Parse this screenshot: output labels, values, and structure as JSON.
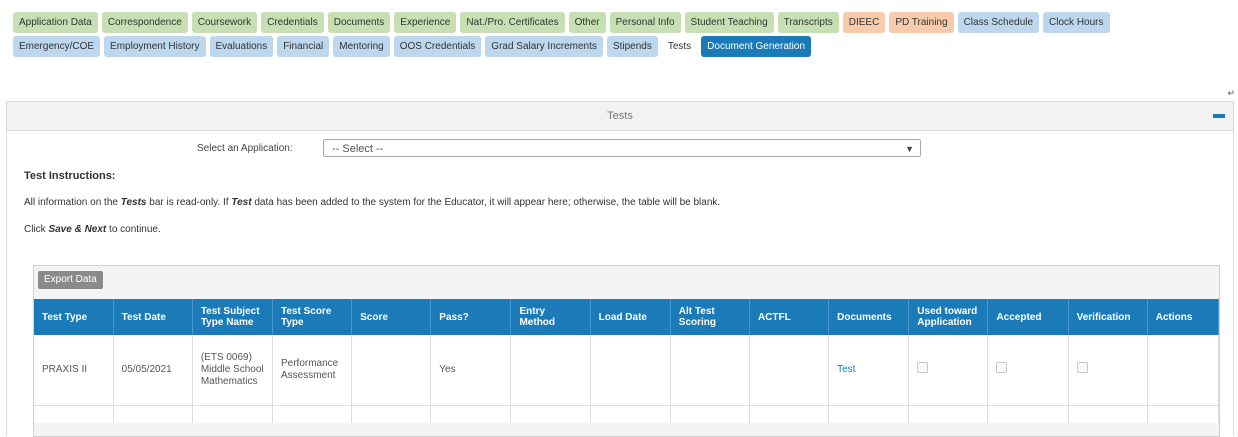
{
  "tabs": {
    "row1": [
      {
        "label": "Application Data",
        "color": "green"
      },
      {
        "label": "Correspondence",
        "color": "green"
      },
      {
        "label": "Coursework",
        "color": "green"
      },
      {
        "label": "Credentials",
        "color": "green"
      },
      {
        "label": "Documents",
        "color": "green"
      },
      {
        "label": "Experience",
        "color": "green"
      },
      {
        "label": "Nat./Pro. Certificates",
        "color": "green"
      },
      {
        "label": "Other",
        "color": "green"
      },
      {
        "label": "Personal Info",
        "color": "green"
      },
      {
        "label": "Student Teaching",
        "color": "green"
      },
      {
        "label": "Transcripts",
        "color": "green"
      },
      {
        "label": "DIEEC",
        "color": "orange"
      },
      {
        "label": "PD Training",
        "color": "orange"
      },
      {
        "label": "Class Schedule",
        "color": "blue"
      },
      {
        "label": "Clock Hours",
        "color": "blue"
      }
    ],
    "row2": [
      {
        "label": "Emergency/COE",
        "color": "blue"
      },
      {
        "label": "Employment History",
        "color": "blue"
      },
      {
        "label": "Evaluations",
        "color": "blue"
      },
      {
        "label": "Financial",
        "color": "blue"
      },
      {
        "label": "Mentoring",
        "color": "blue"
      },
      {
        "label": "OOS Credentials",
        "color": "blue"
      },
      {
        "label": "Grad Salary Increments",
        "color": "blue"
      },
      {
        "label": "Stipends",
        "color": "blue"
      },
      {
        "label": "Tests",
        "color": "plain"
      },
      {
        "label": "Document Generation",
        "color": "active"
      }
    ]
  },
  "corner_mark": "↵",
  "panel": {
    "title": "Tests",
    "select_label": "Select an Application:",
    "select_value": "-- Select --",
    "instructions_title": "Test Instructions:",
    "instr1_a": "All information on the ",
    "instr1_b": "Tests",
    "instr1_c": " bar is read-only.  If ",
    "instr1_d": "Test",
    "instr1_e": " data has been added to the system for the Educator, it will appear here; otherwise, the table will be blank.",
    "instr2_a": "Click ",
    "instr2_b": "Save & Next",
    "instr2_c": " to continue."
  },
  "grid": {
    "export_label": "Export Data",
    "columns": [
      "Test Type",
      "Test Date",
      "Test Subject Type Name",
      "Test Score Type",
      "Score",
      "Pass?",
      "Entry Method",
      "Load Date",
      "Alt Test Scoring",
      "ACTFL",
      "Documents",
      "Used toward Application",
      "Accepted",
      "Verification",
      "Actions"
    ],
    "row": {
      "test_type": "PRAXIS II",
      "test_date": "05/05/2021",
      "subject": "(ETS 0069) Middle School Mathematics",
      "score_type": "Performance Assessment",
      "score": "",
      "pass": "Yes",
      "entry_method": "",
      "load_date": "",
      "alt_scoring": "",
      "actfl": "",
      "documents_link": "Test",
      "actions": ""
    }
  },
  "colors": {
    "tab_green": "#c6e0b4",
    "tab_orange": "#f8cbad",
    "tab_blue": "#bdd7ee",
    "accent": "#1b7ab8"
  }
}
